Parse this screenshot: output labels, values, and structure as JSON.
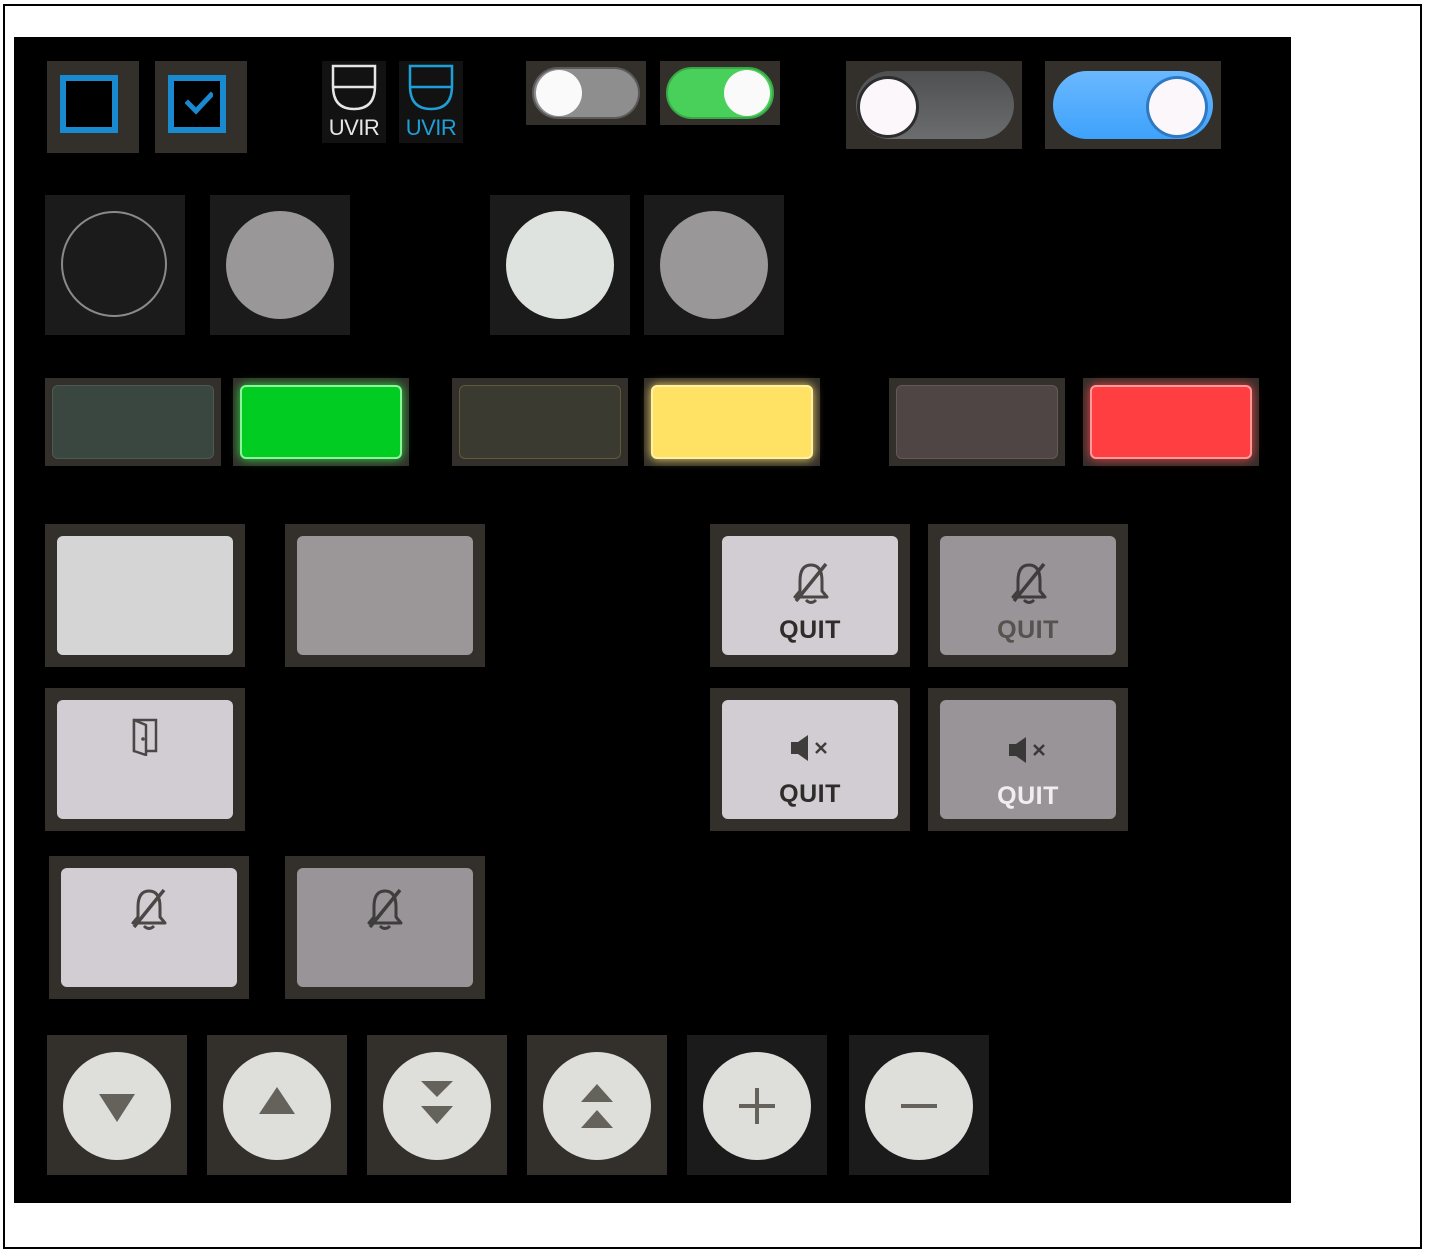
{
  "colors": {
    "panel_bg": "#000000",
    "tile_bg": "#332f2b",
    "accent_blue": "#1a8ad0",
    "toggle_green": "#48d05a",
    "toggle_blue": "#3ea2fb",
    "lamp_green_on": "#00cc22",
    "lamp_yellow_on": "#ffe163",
    "lamp_red_on": "#ff3e42"
  },
  "checkboxes": [
    {
      "state": "unchecked"
    },
    {
      "state": "checked"
    }
  ],
  "uvir_icons": [
    {
      "label": "UVIR",
      "state": "inactive"
    },
    {
      "label": "UVIR",
      "state": "active"
    }
  ],
  "toggles": [
    {
      "state": "off"
    },
    {
      "state": "on"
    },
    {
      "state": "off"
    },
    {
      "state": "on"
    }
  ],
  "radio_buttons": [
    {
      "state": "empty"
    },
    {
      "state": "disabled"
    },
    {
      "state": "selected"
    },
    {
      "state": "disabled"
    }
  ],
  "lamps": [
    {
      "color": "green",
      "state": "off"
    },
    {
      "color": "green",
      "state": "on"
    },
    {
      "color": "yellow",
      "state": "off"
    },
    {
      "color": "yellow",
      "state": "on"
    },
    {
      "color": "red",
      "state": "off"
    },
    {
      "color": "red",
      "state": "on"
    }
  ],
  "quit_buttons": {
    "alarm_quit_label": "QUIT",
    "alarm_quit_disabled_label": "QUIT",
    "sound_quit_label": "QUIT",
    "sound_quit_disabled_label": "QUIT"
  },
  "round_buttons": [
    {
      "icon": "triangle-down-icon"
    },
    {
      "icon": "triangle-up-icon"
    },
    {
      "icon": "double-chevron-down-icon"
    },
    {
      "icon": "double-chevron-up-icon"
    },
    {
      "icon": "plus-icon"
    },
    {
      "icon": "minus-icon"
    }
  ]
}
